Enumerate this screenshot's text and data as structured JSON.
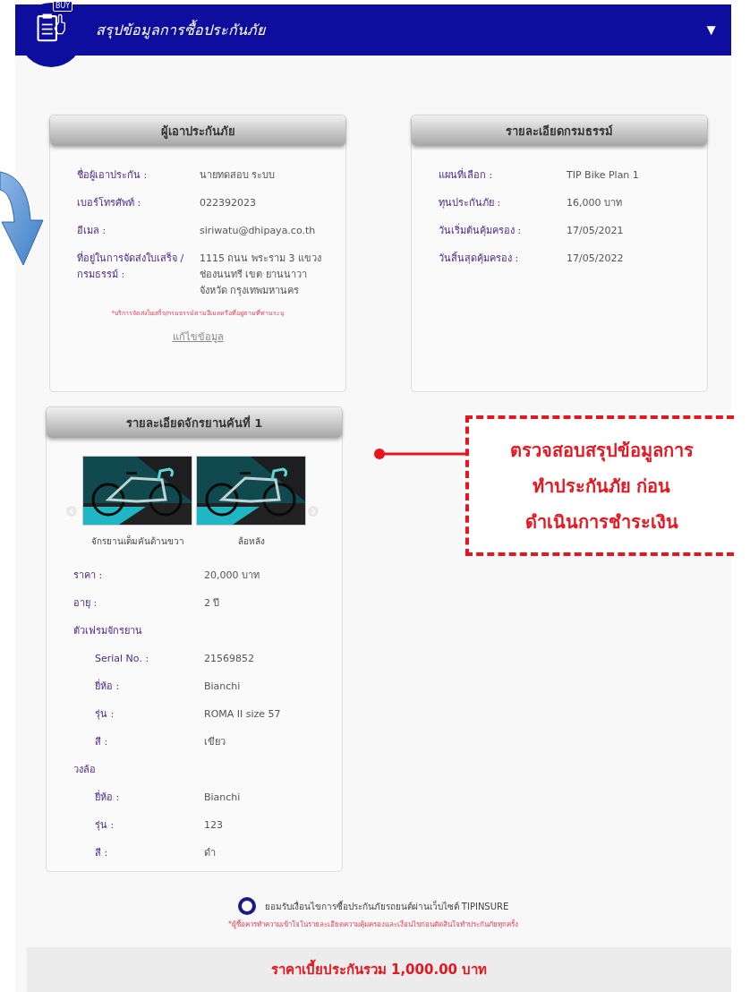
{
  "header": {
    "icon_tag": "BUY",
    "title": "สรุปข้อมูลการซื้อประกันภัย",
    "toggle": "▼"
  },
  "policyholder": {
    "title": "ผู้เอาประกันภัย",
    "rows": [
      {
        "label": "ชื่อผู้เอาประกัน :",
        "value": "นายทดสอบ ระบบ"
      },
      {
        "label": "เบอร์โทรศัพท์ :",
        "value": "022392023"
      },
      {
        "label": "อีเมล :",
        "value": "siriwatu@dhipaya.co.th"
      },
      {
        "label": "ที่อยู่ในการจัดส่งใบเสร็จ / กรมธรรม์ :",
        "value": "1115 ถนน พระราม 3 แขวง ช่องนนทรี เขต ยานนาวา จังหวัด กรุงเทพมหานคร"
      }
    ],
    "note": "*บริการจัดส่งใบเสร็จ/กรมธรรม์ตามอีเมลหรือที่อยู่ตามที่ท่านระบุ",
    "edit_link": "แก้ไขข้อมูล"
  },
  "policy": {
    "title": "รายละเอียดกรมธรรม์",
    "rows": [
      {
        "label": "แผนที่เลือก :",
        "value": "TIP Bike Plan 1"
      },
      {
        "label": "ทุนประกันภัย :",
        "value": "16,000 บาท"
      },
      {
        "label": "วันเริ่มต้นคุ้มครอง :",
        "value": "17/05/2021"
      },
      {
        "label": "วันสิ้นสุดคุ้มครอง :",
        "value": "17/05/2022"
      }
    ]
  },
  "bike": {
    "title": "รายละเอียดจักรยานคันที่ 1",
    "photos": [
      {
        "kind": "picture",
        "caption": "จักรยานเต็มคันด้านขวา"
      },
      {
        "kind": "picture",
        "caption": "ล้อหลัง"
      }
    ],
    "rows": [
      {
        "label": "ราคา :",
        "value": "20,000 บาท"
      },
      {
        "label": "อายุ :",
        "value": "2 ปี"
      },
      {
        "label": "ตัวเฟรมจักรยาน",
        "children": [
          {
            "label": "Serial No. :",
            "value": "21569852"
          },
          {
            "label": "ยี่ห้อ :",
            "value": "Bianchi"
          },
          {
            "label": "รุ่น :",
            "value": "ROMA II size 57"
          },
          {
            "label": "สี :",
            "value": "เขียว"
          }
        ]
      },
      {
        "label": "วงล้อ",
        "children": [
          {
            "label": "ยี่ห้อ :",
            "value": "Bianchi"
          },
          {
            "label": "รุ่น :",
            "value": "123"
          },
          {
            "label": "สี :",
            "value": "ดำ"
          }
        ]
      }
    ]
  },
  "consent": {
    "label": "ยอมรับเงื่อนไขการซื้อประกันภัยรถยนต์ผ่านเว็บไซต์ TIPINSURE",
    "checked": false,
    "note": "*ผู้ซื้อควรทำความเข้าใจในรายละเอียดความคุ้มครองและเงื่อนไขก่อนตัดสินใจทำประกันภัยทุกครั้ง"
  },
  "total": "ราคาเบี้ยประกันรวม 1,000.00 บาท",
  "annotation": {
    "lines": [
      "ตรวจสอบสรุปข้อมูลการ",
      "ทำประกันภัย ก่อน",
      "ดำเนินการชำระเงิน"
    ]
  }
}
